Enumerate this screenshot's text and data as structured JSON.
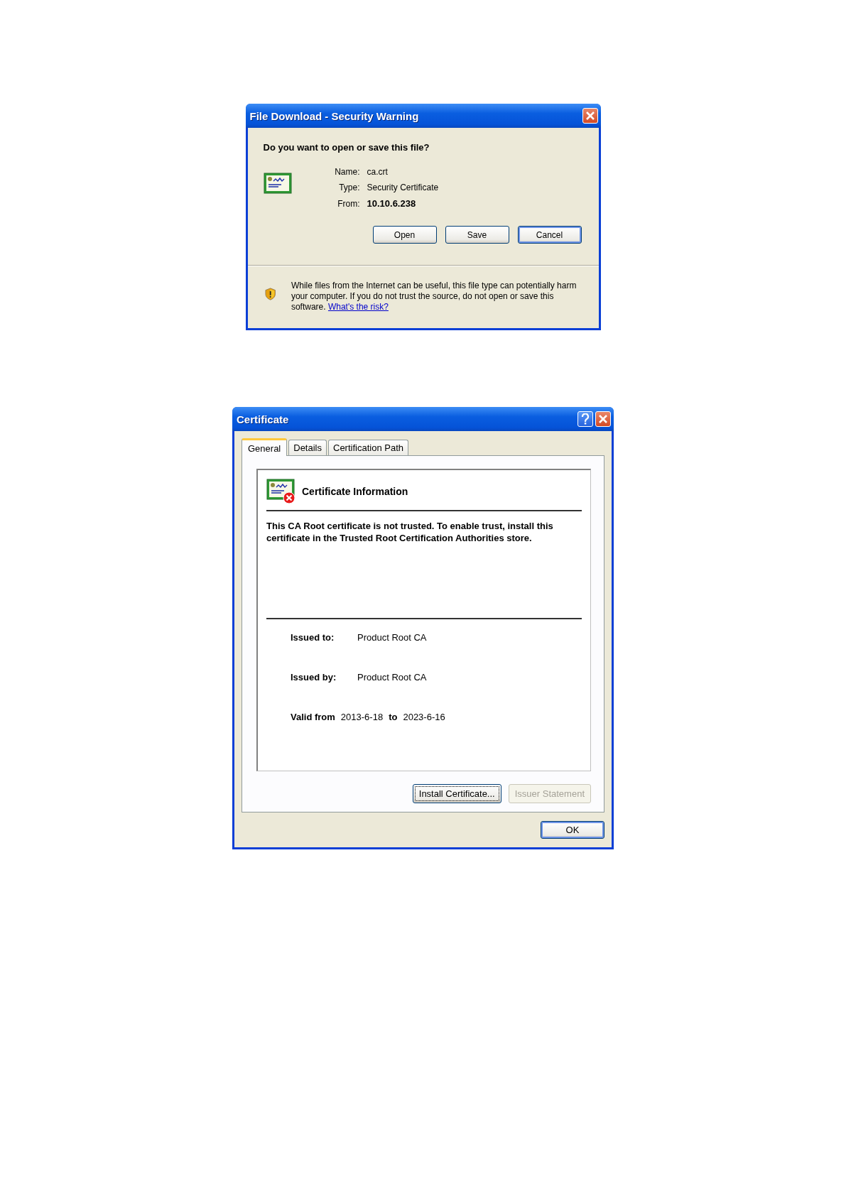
{
  "download_dialog": {
    "title": "File Download - Security Warning",
    "question": "Do you want to open or save this file?",
    "fields": [
      {
        "label": "Name:",
        "value": "ca.crt",
        "bold": false
      },
      {
        "label": "Type:",
        "value": "Security Certificate",
        "bold": false
      },
      {
        "label": "From:",
        "value": "10.10.6.238",
        "bold": true
      }
    ],
    "buttons": [
      {
        "label": "Open",
        "default": false
      },
      {
        "label": "Save",
        "default": false
      },
      {
        "label": "Cancel",
        "default": true
      }
    ],
    "warning": "While files from the Internet can be useful, this file type can potentially harm your computer. If you do not trust the source, do not open or save this software.",
    "link": "What's the risk?"
  },
  "certificate_dialog": {
    "title": "Certificate",
    "tabs": [
      {
        "label": "General",
        "selected": true
      },
      {
        "label": "Details",
        "selected": false
      },
      {
        "label": "Certification Path",
        "selected": false
      }
    ],
    "heading": "Certificate Information",
    "message": "This CA Root certificate is not trusted. To enable trust, install this certificate in the Trusted Root Certification Authorities store.",
    "details": [
      {
        "label": "Issued to:",
        "value": "Product Root CA"
      },
      {
        "label": "Issued by:",
        "value": "Product Root CA"
      }
    ],
    "validity": {
      "label": "Valid from",
      "start": "2013-6-18",
      "to": "to",
      "end": "2023-6-16"
    },
    "buttons": [
      {
        "label": "Install Certificate...",
        "disabled": false
      },
      {
        "label": "Issuer Statement",
        "disabled": true
      }
    ],
    "ok": "OK"
  }
}
